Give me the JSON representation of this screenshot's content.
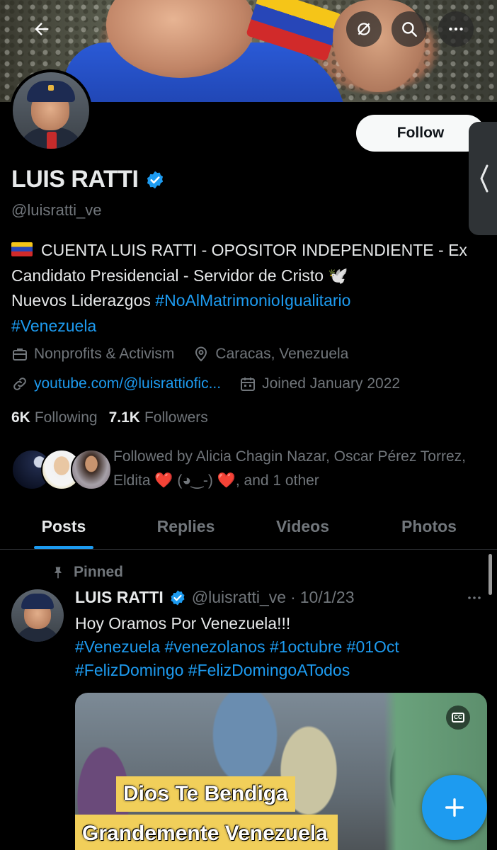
{
  "banner": {
    "back_icon": "back-arrow-icon",
    "grok_icon": "grok-slash-icon",
    "search_icon": "search-icon",
    "more_icon": "more-dots-icon"
  },
  "profile": {
    "name": "LUIS RATTI",
    "handle": "@luisratti_ve",
    "follow_label": "Follow",
    "bio": {
      "line1": "CUENTA LUIS RATTI - OPOSITOR INDEPENDIENTE - Ex Candidato Presidencial - Servidor de Cristo 🕊️",
      "line2_prefix": "Nuevos Liderazgos ",
      "hashtag1": "#NoAlMatrimonioIgualitario",
      "hashtag2": "#Venezuela"
    },
    "category": "Nonprofits & Activism",
    "location": "Caracas, Venezuela",
    "website": "youtube.com/@luisrattiofic...",
    "joined": "Joined January 2022",
    "following_count": "6K",
    "following_label": "Following",
    "followers_count": "7.1K",
    "followers_label": "Followers",
    "followed_by": "Followed by Alicia Chagin Nazar, Oscar Pérez Torrez, Eldita ❤️ (◕‿-) ❤️, and 1 other"
  },
  "tabs": [
    "Posts",
    "Replies",
    "Videos",
    "Photos"
  ],
  "post": {
    "pinned_label": "Pinned",
    "name": "LUIS RATTI",
    "handle": "@luisratti_ve",
    "separator": "·",
    "date": "10/1/23",
    "text_line1": "Hoy Oramos Por Venezuela!!!",
    "hashtags": [
      "#Venezuela",
      "#venezolanos",
      "#1octubre",
      "#01Oct",
      "#FelizDomingo",
      "#FelizDomingoATodos"
    ],
    "media_caption1": "Dios Te Bendiga",
    "media_caption2": "Grandemente Venezuela",
    "cc_label": "CC"
  },
  "colors": {
    "accent": "#1d9bf0",
    "text_primary": "#e7e9ea",
    "text_secondary": "#71767b",
    "background": "#000000"
  }
}
